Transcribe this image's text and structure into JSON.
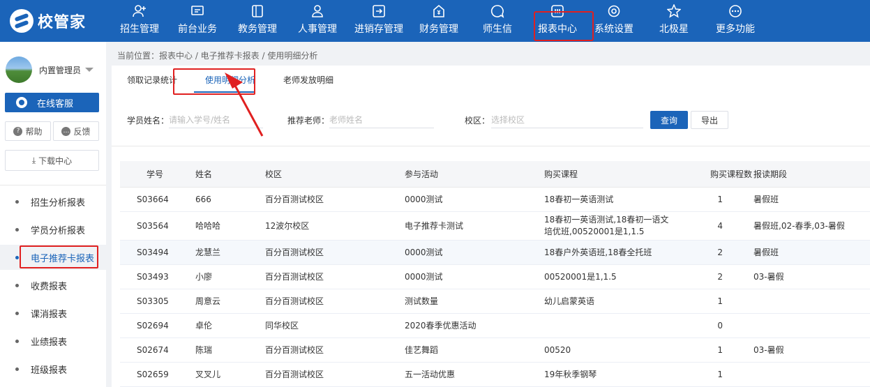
{
  "header": {
    "logo_text": "校管家",
    "nav": [
      {
        "label": "招生管理",
        "icon": "user-plus-icon"
      },
      {
        "label": "前台业务",
        "icon": "monitor-icon"
      },
      {
        "label": "教务管理",
        "icon": "book-icon"
      },
      {
        "label": "人事管理",
        "icon": "person-icon"
      },
      {
        "label": "进销存管理",
        "icon": "inventory-icon"
      },
      {
        "label": "财务管理",
        "icon": "finance-icon"
      },
      {
        "label": "师生信",
        "icon": "chat-icon"
      },
      {
        "label": "报表中心",
        "icon": "report-icon"
      },
      {
        "label": "系统设置",
        "icon": "settings-icon"
      },
      {
        "label": "北极星",
        "icon": "star-icon"
      },
      {
        "label": "更多功能",
        "icon": "more-icon"
      }
    ],
    "active_nav": "报表中心",
    "highlight_color": "#e02020",
    "brand_color": "#1b64b9"
  },
  "sidebar": {
    "user_name": "内置管理员",
    "service_button": "在线客服",
    "help_button": "帮助",
    "feedback_button": "反馈",
    "download_button": "下载中心",
    "menu": [
      "招生分析报表",
      "学员分析报表",
      "电子推荐卡报表",
      "收费报表",
      "课消报表",
      "业绩报表",
      "班级报表"
    ],
    "active_menu": "电子推荐卡报表"
  },
  "breadcrumb": "当前位置：报表中心 / 电子推荐卡报表 / 使用明细分析",
  "tabs": [
    "领取记录统计",
    "使用明细分析",
    "老师发放明细"
  ],
  "active_tab": "使用明细分析",
  "filters": {
    "student_label": "学员姓名：",
    "student_placeholder": "请输入学号/姓名",
    "teacher_label": "推荐老师：",
    "teacher_placeholder": "老师姓名",
    "campus_label": "校区：",
    "campus_placeholder": "选择校区",
    "query_button": "查询",
    "export_button": "导出"
  },
  "table": {
    "columns": [
      "学号",
      "姓名",
      "校区",
      "参与活动",
      "购买课程",
      "购买课程数",
      "报读期段"
    ],
    "rows": [
      {
        "id": "S03664",
        "name": "666",
        "campus": "百分百测试校区",
        "activity": "0000测试",
        "course": "18春初一英语测试",
        "count": "1",
        "period": "暑假班"
      },
      {
        "id": "S03564",
        "name": "哈哈哈",
        "campus": "12波尔校区",
        "activity": "电子推荐卡测试",
        "course": "18春初一英语测试,18春初一语文培优班,00520001是1,1.5",
        "count": "4",
        "period": "暑假班,02-春季,03-暑假"
      },
      {
        "id": "S03494",
        "name": "龙慧兰",
        "campus": "百分百测试校区",
        "activity": "0000测试",
        "course": "18春户外英语班,18春全托班",
        "count": "2",
        "period": "暑假班"
      },
      {
        "id": "S03493",
        "name": "小廖",
        "campus": "百分百测试校区",
        "activity": "0000测试",
        "course": "00520001是1,1.5",
        "count": "2",
        "period": "03-暑假"
      },
      {
        "id": "S03305",
        "name": "周意云",
        "campus": "百分百测试校区",
        "activity": "测试数量",
        "course": "幼儿启蒙英语",
        "count": "1",
        "period": ""
      },
      {
        "id": "S02694",
        "name": "卓伦",
        "campus": "同华校区",
        "activity": "2020春季优惠活动",
        "course": "",
        "count": "0",
        "period": ""
      },
      {
        "id": "S02674",
        "name": "陈瑞",
        "campus": "百分百测试校区",
        "activity": "佳艺舞蹈",
        "course": "00520",
        "count": "1",
        "period": "03-暑假"
      },
      {
        "id": "S02659",
        "name": "叉叉儿",
        "campus": "百分百测试校区",
        "activity": "五一活动优惠",
        "course": "19年秋季钢琴",
        "count": "1",
        "period": ""
      }
    ]
  }
}
